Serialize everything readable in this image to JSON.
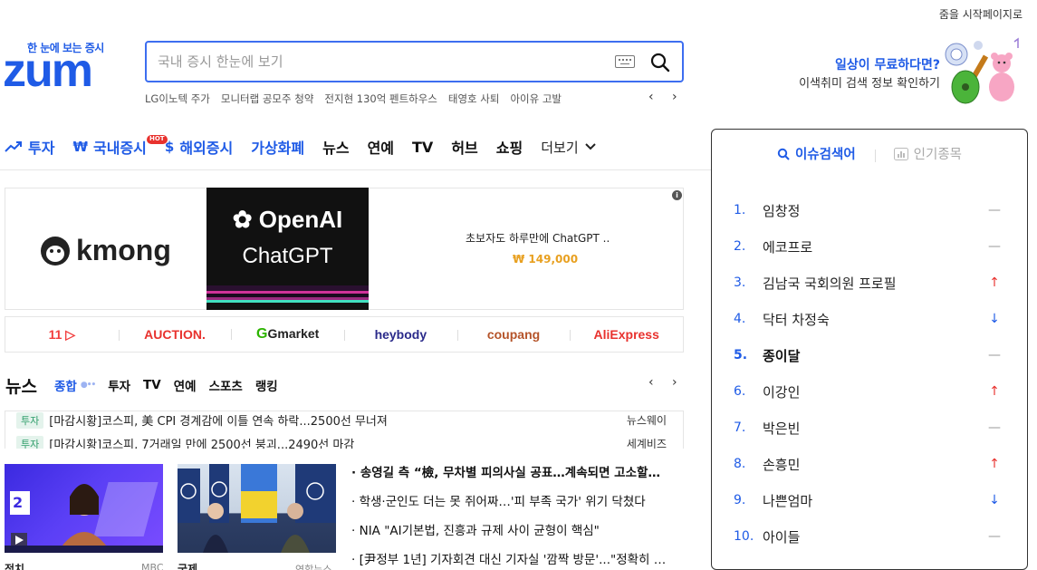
{
  "header": {
    "start_page_link": "줌을 시작페이지로",
    "logo_tagline": "한 눈에 보는 증시",
    "logo_text": "zum"
  },
  "search": {
    "placeholder": "국내 증시 한눈에 보기",
    "trending_links": [
      "LG이노텍 주가",
      "모니터랩 공모주 청약",
      "전지현 130억 펜트하우스",
      "태영호 사퇴",
      "아이유 고발"
    ]
  },
  "promo": {
    "line1": "일상이 무료하다면?",
    "line2": "이색취미 검색 정보 확인하기"
  },
  "nav": {
    "items": [
      {
        "label": "투자",
        "icon": "trend-up-icon",
        "style": "blue"
      },
      {
        "label": "국내증시",
        "icon": "won-icon",
        "style": "blue",
        "badge": "HOT"
      },
      {
        "label": "해외증시",
        "icon": "dollar-icon",
        "style": "blue"
      },
      {
        "label": "가상화폐",
        "style": "blue"
      },
      {
        "label": "뉴스",
        "style": "black"
      },
      {
        "label": "연예",
        "style": "black"
      },
      {
        "label": "TV",
        "style": "black"
      },
      {
        "label": "허브",
        "style": "black"
      },
      {
        "label": "쇼핑",
        "style": "black"
      }
    ],
    "more_label": "더보기"
  },
  "ad": {
    "brand": "kmong",
    "product_title": "OpenAI",
    "product_sub": "ChatGPT",
    "description": "초보자도 하루만에 ChatGPT ..",
    "price": "₩ 149,000",
    "info_label": "i"
  },
  "shops": [
    {
      "label": "11",
      "color": "#f23d3d"
    },
    {
      "label": "AUCTION.",
      "color": "#e8322e"
    },
    {
      "label": "Gmarket",
      "color": "#222222"
    },
    {
      "label": "heybody",
      "color": "#2a2a8a"
    },
    {
      "label": "coupang",
      "color": "#b5542a"
    },
    {
      "label": "AliExpress",
      "color": "#e8322e"
    }
  ],
  "news": {
    "title": "뉴스",
    "tabs": [
      "종합",
      "투자",
      "TV",
      "연예",
      "스포츠",
      "랭킹"
    ],
    "headlines": [
      {
        "category": "투자",
        "title": "[마감시황]코스피, 美 CPI 경계감에 이틀 연속 하락...2500선 무너져",
        "source": "뉴스웨이"
      },
      {
        "category": "투자",
        "title": "[마감시황]코스피, 7거래일 만에 2500선 붕괴...2490선 마감",
        "source": "세계비즈"
      }
    ],
    "photos": [
      {
        "category": "정치",
        "source": "MBC",
        "badge": "2"
      },
      {
        "category": "국제",
        "source": "연합뉴스"
      }
    ],
    "bullets": [
      "송영길 측 “檢, 무차별 피의사실 공표…계속되면 고소할…",
      "학생·군인도 더는 못 쥐어짜…'피 부족 국가' 위기 닥쳤다",
      "NIA \"AI기본법, 진흥과 규제 사이 균형이 핵심\"",
      "[尹정부 1년] 기자회견 대신 기자실 '깜짝 방문'...\"정확히 …"
    ]
  },
  "issue_panel": {
    "tab_active": "이슈검색어",
    "tab_inactive": "인기종목",
    "ranks": [
      {
        "rank": "1.",
        "keyword": "임창정",
        "trend": "same"
      },
      {
        "rank": "2.",
        "keyword": "에코프로",
        "trend": "same"
      },
      {
        "rank": "3.",
        "keyword": "김남국 국회의원 프로필",
        "trend": "up"
      },
      {
        "rank": "4.",
        "keyword": "닥터 차정숙",
        "trend": "down"
      },
      {
        "rank": "5.",
        "keyword": "종이달",
        "trend": "same"
      },
      {
        "rank": "6.",
        "keyword": "이강인",
        "trend": "up"
      },
      {
        "rank": "7.",
        "keyword": "박은빈",
        "trend": "same"
      },
      {
        "rank": "8.",
        "keyword": "손흥민",
        "trend": "up"
      },
      {
        "rank": "9.",
        "keyword": "나쁜엄마",
        "trend": "down"
      },
      {
        "rank": "10.",
        "keyword": "아이들",
        "trend": "same"
      }
    ],
    "colors": {
      "up": "#e8322e",
      "down": "#1f5be6",
      "same": "#999999"
    }
  }
}
